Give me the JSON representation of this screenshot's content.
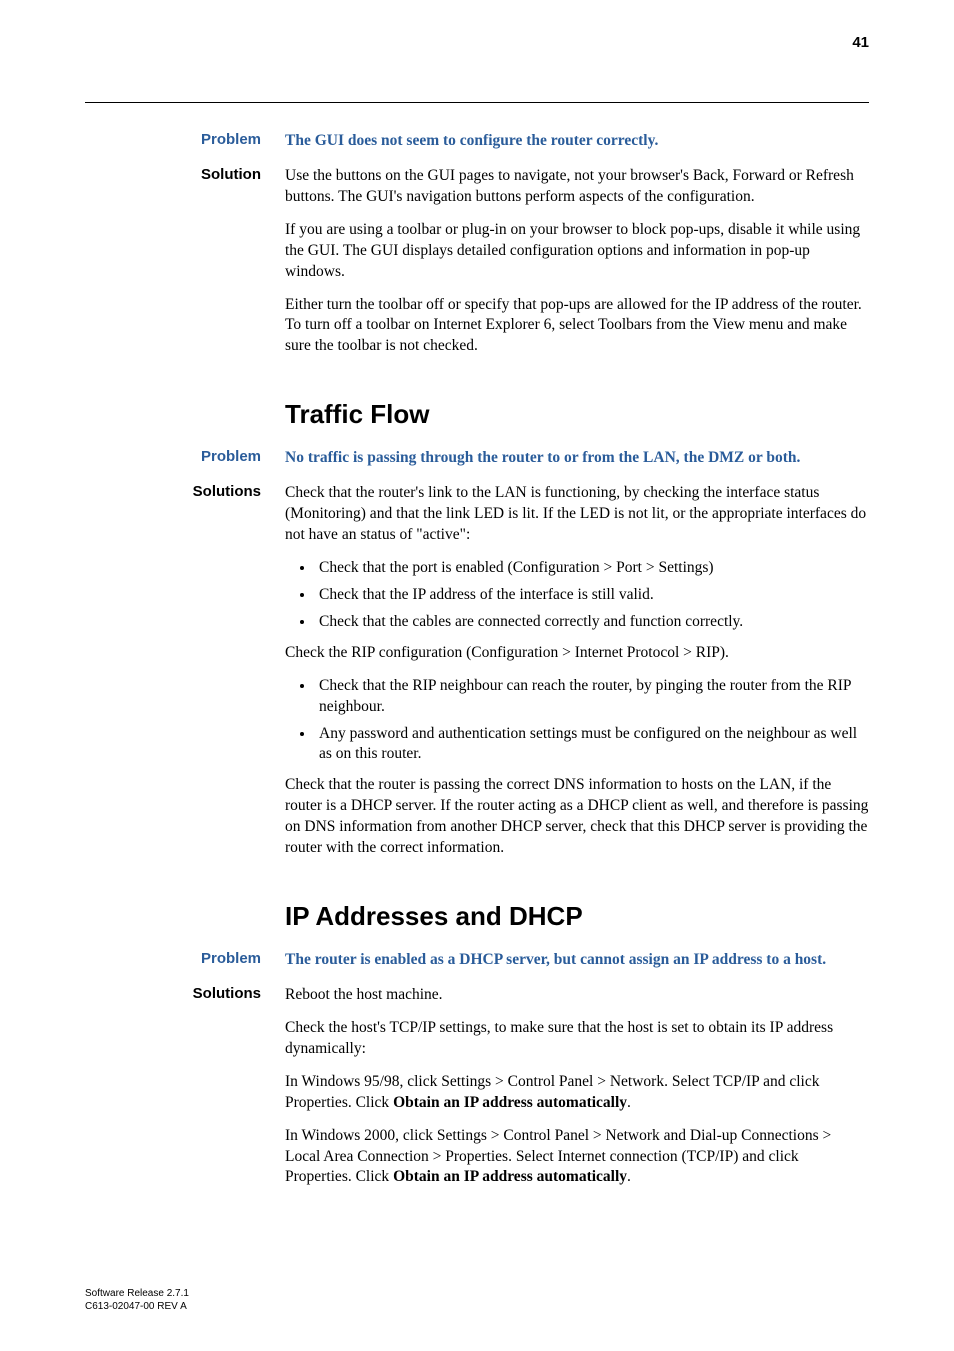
{
  "page_number": "41",
  "problem1": {
    "label": "Problem",
    "text": "The GUI does not seem to configure the router correctly."
  },
  "solution1": {
    "label": "Solution",
    "p1": "Use the buttons on the GUI pages to navigate, not your browser's Back, Forward or Refresh buttons. The GUI's navigation buttons perform aspects of the configuration.",
    "p2": "If you are using a toolbar or plug-in on your browser to block pop-ups, disable it while using the GUI. The GUI displays detailed configuration options and information in pop-up windows.",
    "p3": "Either turn the toolbar off or specify that pop-ups are allowed for the IP address of the router. To turn off a toolbar on Internet Explorer 6, select Toolbars from the View menu and make sure the toolbar is not checked."
  },
  "section_traffic": "Traffic Flow",
  "problem2": {
    "label": "Problem",
    "text": "No traffic is passing through the router to or from the LAN, the DMZ or both."
  },
  "solutions2": {
    "label": "Solutions",
    "p1": "Check that the router's link to the LAN is functioning, by checking the interface status (Monitoring) and that the link LED is lit. If the LED is not lit, or the appropriate interfaces do not have an status of \"active\":",
    "bullets1": [
      "Check that the port is enabled (Configuration > Port > Settings)",
      "Check that the IP address of the interface is still valid.",
      "Check that the cables are connected correctly and function correctly."
    ],
    "p2": "Check the RIP configuration (Configuration > Internet Protocol > RIP).",
    "bullets2": [
      "Check that the RIP neighbour can reach the router, by pinging the router from the RIP neighbour.",
      "Any password and authentication settings must be configured on the neighbour as well as on this router."
    ],
    "p3": "Check that the router is passing the correct DNS information to hosts on the LAN, if the router is a DHCP server. If the router acting as a DHCP client as well, and therefore is passing on DNS information from another DHCP server, check that this DHCP server is providing the router with the correct information."
  },
  "section_ip": "IP Addresses and DHCP",
  "problem3": {
    "label": "Problem",
    "text": "The router is enabled as a DHCP server, but cannot assign an IP address to a host."
  },
  "solutions3": {
    "label": "Solutions",
    "p1": "Reboot the host machine.",
    "p2": "Check the host's TCP/IP settings, to make sure that the host is set to obtain its IP address dynamically:",
    "p3_pre": "In Windows 95/98, click Settings > Control Panel > Network. Select TCP/IP and click Properties. Click ",
    "p3_bold": "Obtain an IP address automatically",
    "p3_post": ".",
    "p4_pre": "In Windows 2000, click Settings > Control Panel > Network and Dial-up Connections > Local Area Connection > Properties. Select Internet connection (TCP/IP) and click Properties. Click ",
    "p4_bold": "Obtain an IP address automatically",
    "p4_post": "."
  },
  "footer": {
    "line1": "Software Release 2.7.1",
    "line2": "C613-02047-00 REV A"
  }
}
